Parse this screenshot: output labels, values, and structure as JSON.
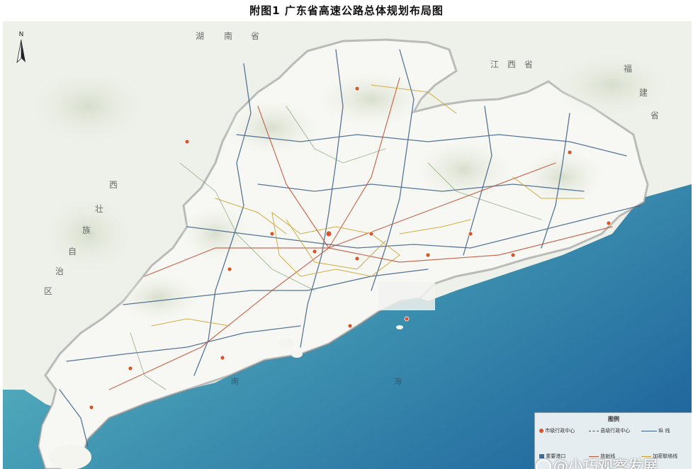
{
  "title": "附图1  广东省高速公路总体规划布局图",
  "north": {
    "letter": "N",
    "icon": "north-arrow-icon"
  },
  "region_labels": {
    "hunan": [
      "湖",
      "南",
      "省"
    ],
    "jiangxi": [
      "江",
      "西",
      "省"
    ],
    "fujian": [
      "福",
      "建",
      "省"
    ],
    "guangxi": [
      "西",
      "壮",
      "族",
      "自",
      "治",
      "区"
    ]
  },
  "sea_labels": [
    "南",
    "海"
  ],
  "legend": {
    "title": "图例",
    "items": [
      {
        "icon": "city-center-icon",
        "label": "市级行政中心"
      },
      {
        "icon": "county-center-icon",
        "label": "县级行政中心"
      },
      {
        "icon": "vertical-line-icon",
        "label": "纵  线"
      },
      {
        "icon": "port-icon",
        "label": "重要港口"
      },
      {
        "icon": "radial-line-icon",
        "label": "放射线"
      },
      {
        "icon": "link-line-icon",
        "label": "加密联络线"
      }
    ]
  },
  "watermark": "@小巧观察发展",
  "colors": {
    "sea_deep": "#2a6fa0",
    "sea_shallow": "#7cc3c6",
    "land": "#f4f5ef",
    "terrain": "#dfe6d6",
    "road_main": "#3b5f86",
    "road_radial": "#c0523a",
    "road_link": "#c9a227",
    "city": "#d8542a"
  }
}
